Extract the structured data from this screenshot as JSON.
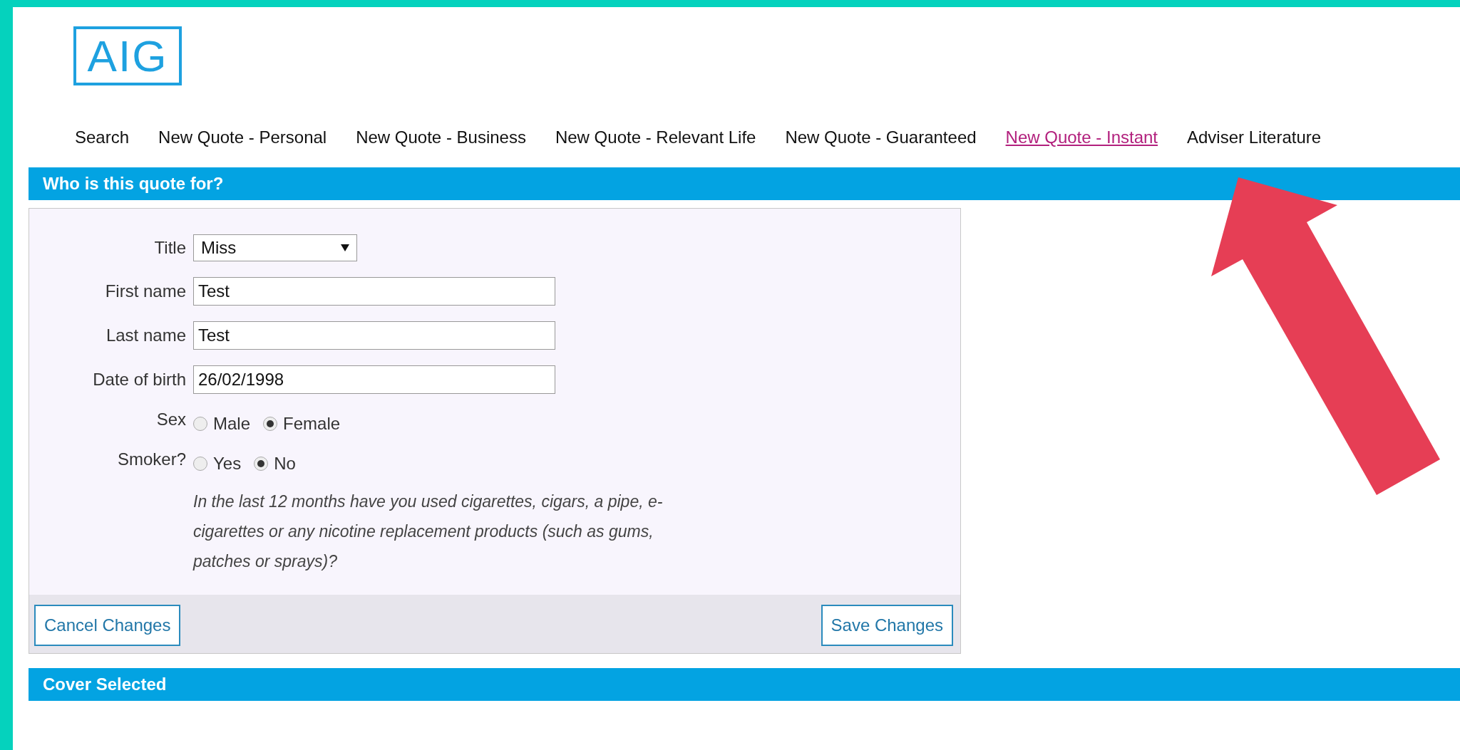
{
  "logo": {
    "text": "AIG"
  },
  "nav": [
    {
      "label": "Search",
      "selected": false
    },
    {
      "label": "New Quote - Personal",
      "selected": false
    },
    {
      "label": "New Quote - Business",
      "selected": false
    },
    {
      "label": "New Quote - Relevant Life",
      "selected": false
    },
    {
      "label": "New Quote - Guaranteed",
      "selected": false
    },
    {
      "label": "New Quote - Instant",
      "selected": true
    },
    {
      "label": "Adviser Literature",
      "selected": false
    }
  ],
  "section": {
    "title": "Who is this quote for?"
  },
  "form": {
    "title": {
      "label": "Title",
      "value": "Miss"
    },
    "fields": [
      {
        "label": "First name",
        "value": "Test"
      },
      {
        "label": "Last name",
        "value": "Test"
      },
      {
        "label": "Date of birth",
        "value": "26/02/1998"
      }
    ],
    "radio_groups": [
      {
        "label": "Sex",
        "options": [
          {
            "label": "Male",
            "selected": false
          },
          {
            "label": "Female",
            "selected": true
          }
        ]
      },
      {
        "label": "Smoker?",
        "options": [
          {
            "label": "Yes",
            "selected": false
          },
          {
            "label": "No",
            "selected": true
          }
        ]
      }
    ],
    "note": "In the last 12 months have you used cigarettes, cigars, a pipe, e-cigarettes or any nicotine replacement products (such as gums, patches or sprays)?",
    "buttons": {
      "cancel": "Cancel Changes",
      "save": "Save Changes"
    }
  },
  "section2": {
    "title": "Cover Selected"
  }
}
